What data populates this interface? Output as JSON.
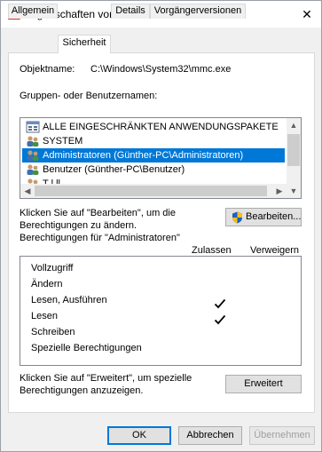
{
  "window": {
    "title": "Eigenschaften von mmc.exe",
    "close_glyph": "✕"
  },
  "tabs": [
    {
      "label": "Allgemein",
      "active": false
    },
    {
      "label": "Sicherheit",
      "active": true
    },
    {
      "label": "Details",
      "active": false
    },
    {
      "label": "Vorgängerversionen",
      "active": false
    }
  ],
  "object": {
    "label": "Objektname:",
    "value": "C:\\Windows\\System32\\mmc.exe"
  },
  "groups": {
    "label": "Gruppen- oder Benutzernamen:",
    "items": [
      {
        "label": "ALLE EINGESCHRÄNKTEN ANWENDUNGSPAKETE",
        "icon": "app-package-icon",
        "selected": false
      },
      {
        "label": "SYSTEM",
        "icon": "users-group-icon",
        "selected": false
      },
      {
        "label": "Administratoren (Günther-PC\\Administratoren)",
        "icon": "users-group-icon",
        "selected": true
      },
      {
        "label": "Benutzer (Günther-PC\\Benutzer)",
        "icon": "users-group-icon",
        "selected": false
      },
      {
        "label": "T    l  ll",
        "icon": "users-group-icon",
        "selected": false
      }
    ]
  },
  "edit": {
    "hint": "Klicken Sie auf \"Bearbeiten\", um die Berechtigungen zu ändern.",
    "hint_line1": "Klicken Sie auf \"Bearbeiten\", um die",
    "hint_line2": "Berechtigungen zu ändern.",
    "button_label": "Bearbeiten...",
    "button_icon": "uac-shield-icon"
  },
  "permissions": {
    "title": "Berechtigungen für \"Administratoren\"",
    "col_allow": "Zulassen",
    "col_deny": "Verweigern",
    "rows": [
      {
        "label": "Vollzugriff",
        "allow": false,
        "deny": false
      },
      {
        "label": "Ändern",
        "allow": false,
        "deny": false
      },
      {
        "label": "Lesen, Ausführen",
        "allow": true,
        "deny": false
      },
      {
        "label": "Lesen",
        "allow": true,
        "deny": false
      },
      {
        "label": "Schreiben",
        "allow": false,
        "deny": false
      },
      {
        "label": "Spezielle Berechtigungen",
        "allow": false,
        "deny": false
      }
    ]
  },
  "advanced": {
    "hint_line1": "Klicken Sie auf \"Erweitert\", um spezielle",
    "hint_line2": "Berechtigungen anzuzeigen.",
    "button_label": "Erweitert"
  },
  "footer": {
    "ok": "OK",
    "cancel": "Abbrechen",
    "apply": "Übernehmen"
  },
  "colors": {
    "selection": "#0078d7",
    "shield_blue": "#1f5fbf",
    "shield_yellow": "#f2c01d"
  }
}
